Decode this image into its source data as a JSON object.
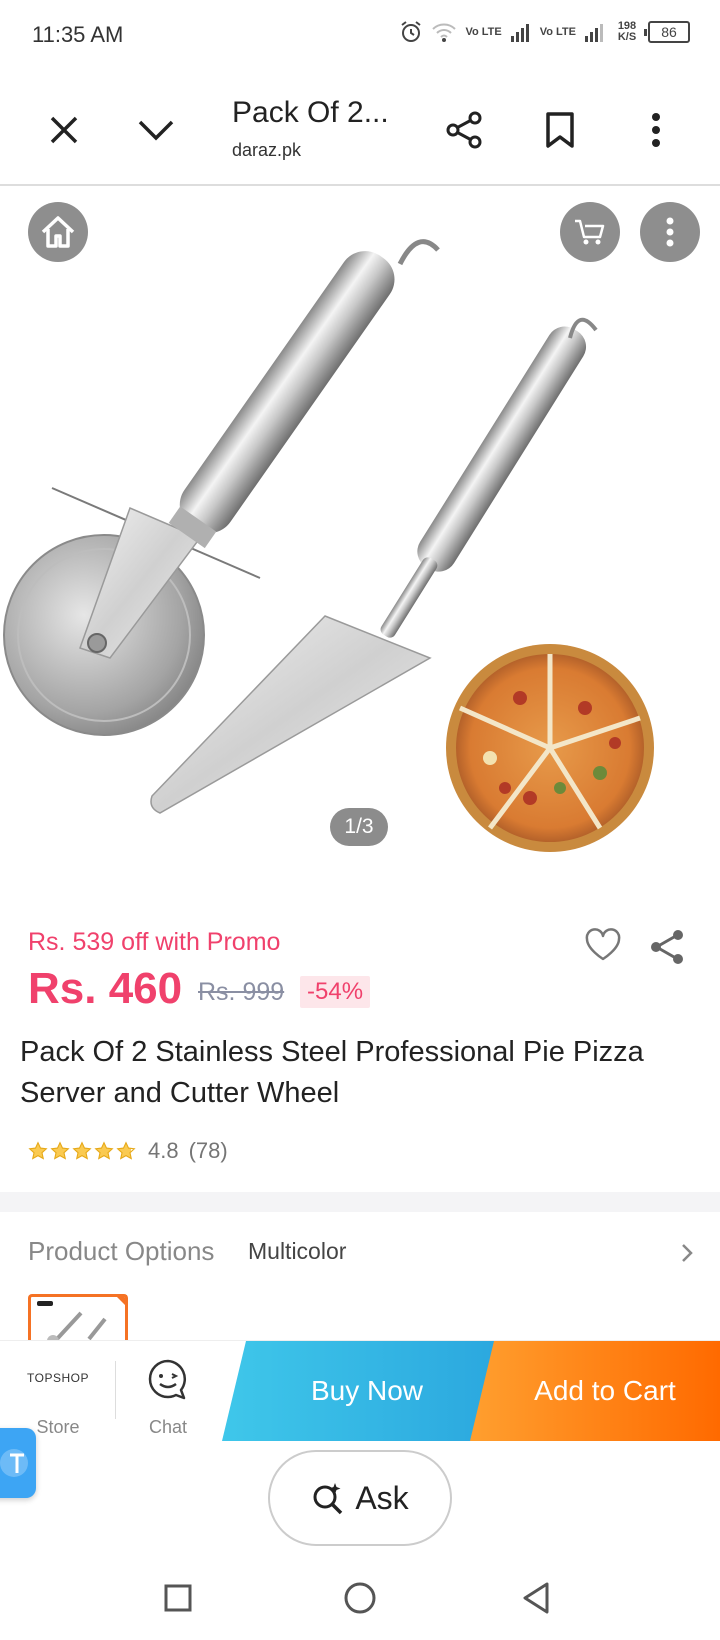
{
  "status_bar": {
    "time": "11:35 AM",
    "net1": "Vo LTE",
    "net2": "Vo LTE",
    "speed": "198 K/S",
    "battery": "86"
  },
  "browser": {
    "title": "Pack Of 2...",
    "url": "daraz.pk"
  },
  "gallery": {
    "pager": "1/3"
  },
  "product": {
    "promo": "Rs. 539 off with Promo",
    "price": "Rs. 460",
    "old_price": "Rs. 999",
    "discount": "-54%",
    "title": "Pack Of 2 Stainless Steel Professional Pie Pizza Server and Cutter Wheel",
    "rating": {
      "stars": 4.8,
      "value": "4.8",
      "count": "(78)"
    }
  },
  "options": {
    "label": "Product Options",
    "value": "Multicolor"
  },
  "actions": {
    "store_logo": "TOPSHOP",
    "store_label": "Store",
    "chat_label": "Chat",
    "buy_now": "Buy Now",
    "add_to_cart": "Add to Cart"
  },
  "ask": {
    "label": "Ask"
  },
  "colors": {
    "price": "#f0416c",
    "buy_now": "#2aa6de",
    "add_to_cart": "#ff6a00"
  }
}
